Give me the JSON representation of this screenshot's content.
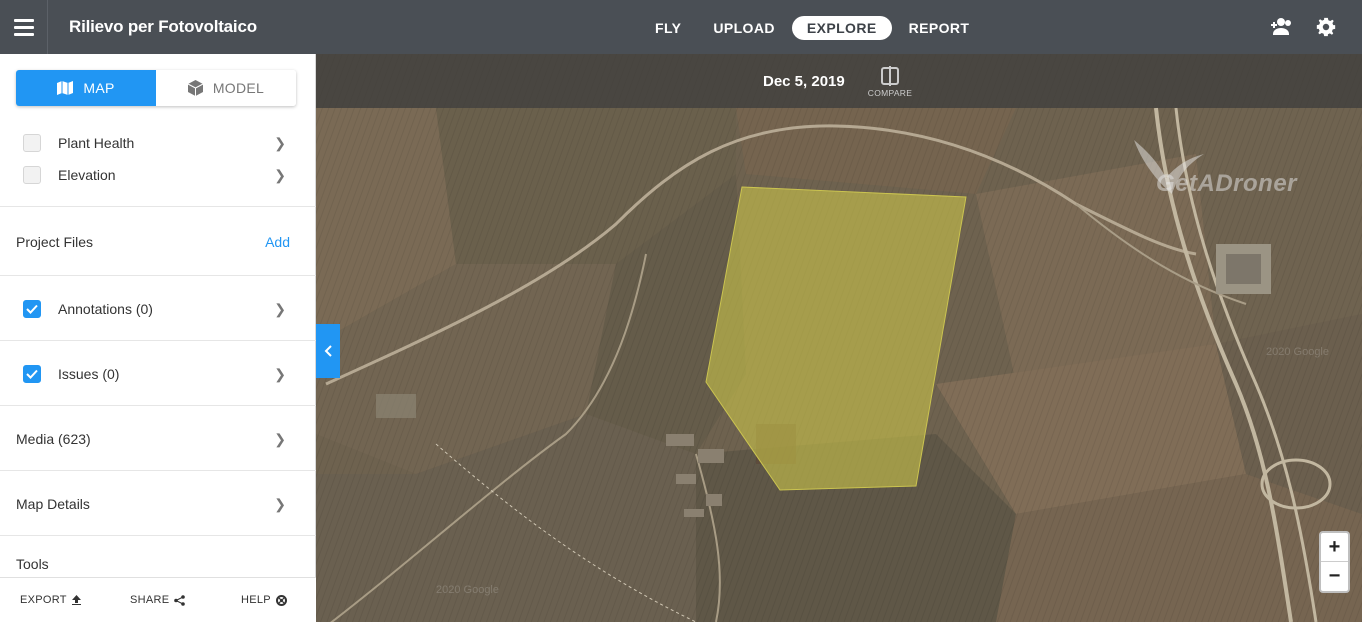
{
  "header": {
    "title": "Rilievo per Fotovoltaico",
    "nav": [
      {
        "label": "FLY",
        "active": false
      },
      {
        "label": "UPLOAD",
        "active": false
      },
      {
        "label": "EXPLORE",
        "active": true
      },
      {
        "label": "REPORT",
        "active": false
      }
    ],
    "icons": [
      "menu-icon",
      "add-user-icon",
      "gear-icon"
    ]
  },
  "sidebar": {
    "view_toggle": {
      "map_label": "MAP",
      "model_label": "MODEL",
      "selected": "MAP"
    },
    "layers": [
      {
        "label": "Plant Health",
        "checked": false
      },
      {
        "label": "Elevation",
        "checked": false
      }
    ],
    "project_files": {
      "label": "Project Files",
      "action": "Add"
    },
    "annotations": {
      "label": "Annotations (0)",
      "checked": true
    },
    "issues": {
      "label": "Issues (0)",
      "checked": true
    },
    "media": {
      "label": "Media (623)"
    },
    "map_details": {
      "label": "Map Details"
    },
    "tools": {
      "label": "Tools"
    },
    "footer": {
      "export": "EXPORT",
      "share": "SHARE",
      "help": "HELP"
    }
  },
  "map": {
    "date": "Dec 5, 2019",
    "compare_label": "COMPARE",
    "watermark": "GetADroner",
    "zoom_in": "+",
    "zoom_out": "−",
    "imagery_credit": "2020 Google",
    "overlay_color": "#c8c24a",
    "accent_color": "#2196f3"
  }
}
